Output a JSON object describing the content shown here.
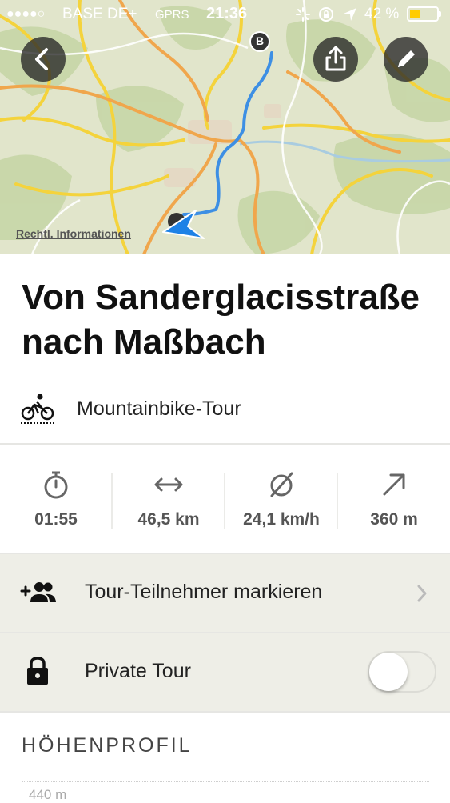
{
  "status_bar": {
    "signal": "●●●●○",
    "carrier": "BASE DE+",
    "network": "GPRS",
    "time": "21:36",
    "battery_percent": "42 %",
    "battery_level": 0.42
  },
  "map": {
    "legal_link": "Rechtl. Informationen",
    "end_marker": "B",
    "route_color": "#3d8fe4"
  },
  "header_buttons": {
    "back": "back-arrow-icon",
    "share": "share-icon",
    "edit": "pencil-icon"
  },
  "tour": {
    "title": "Von Sanderglacisstraße nach Maßbach",
    "sport": "Mountainbike-Tour",
    "sport_icon": "mountainbike-icon"
  },
  "stats": [
    {
      "icon": "stopwatch-icon",
      "value": "01:55"
    },
    {
      "icon": "distance-icon",
      "value": "46,5 km"
    },
    {
      "icon": "average-speed-icon",
      "value": "24,1 km/h"
    },
    {
      "icon": "uphill-icon",
      "value": "360 m"
    }
  ],
  "actions": {
    "participants_label": "Tour-Teilnehmer markieren",
    "private_label": "Private Tour",
    "private_enabled": false
  },
  "elevation": {
    "section_title": "HÖHENPROFIL",
    "first_axis_label": "440 m"
  },
  "colors": {
    "row_background": "#eeeee7",
    "status_text": "#ffffff"
  }
}
